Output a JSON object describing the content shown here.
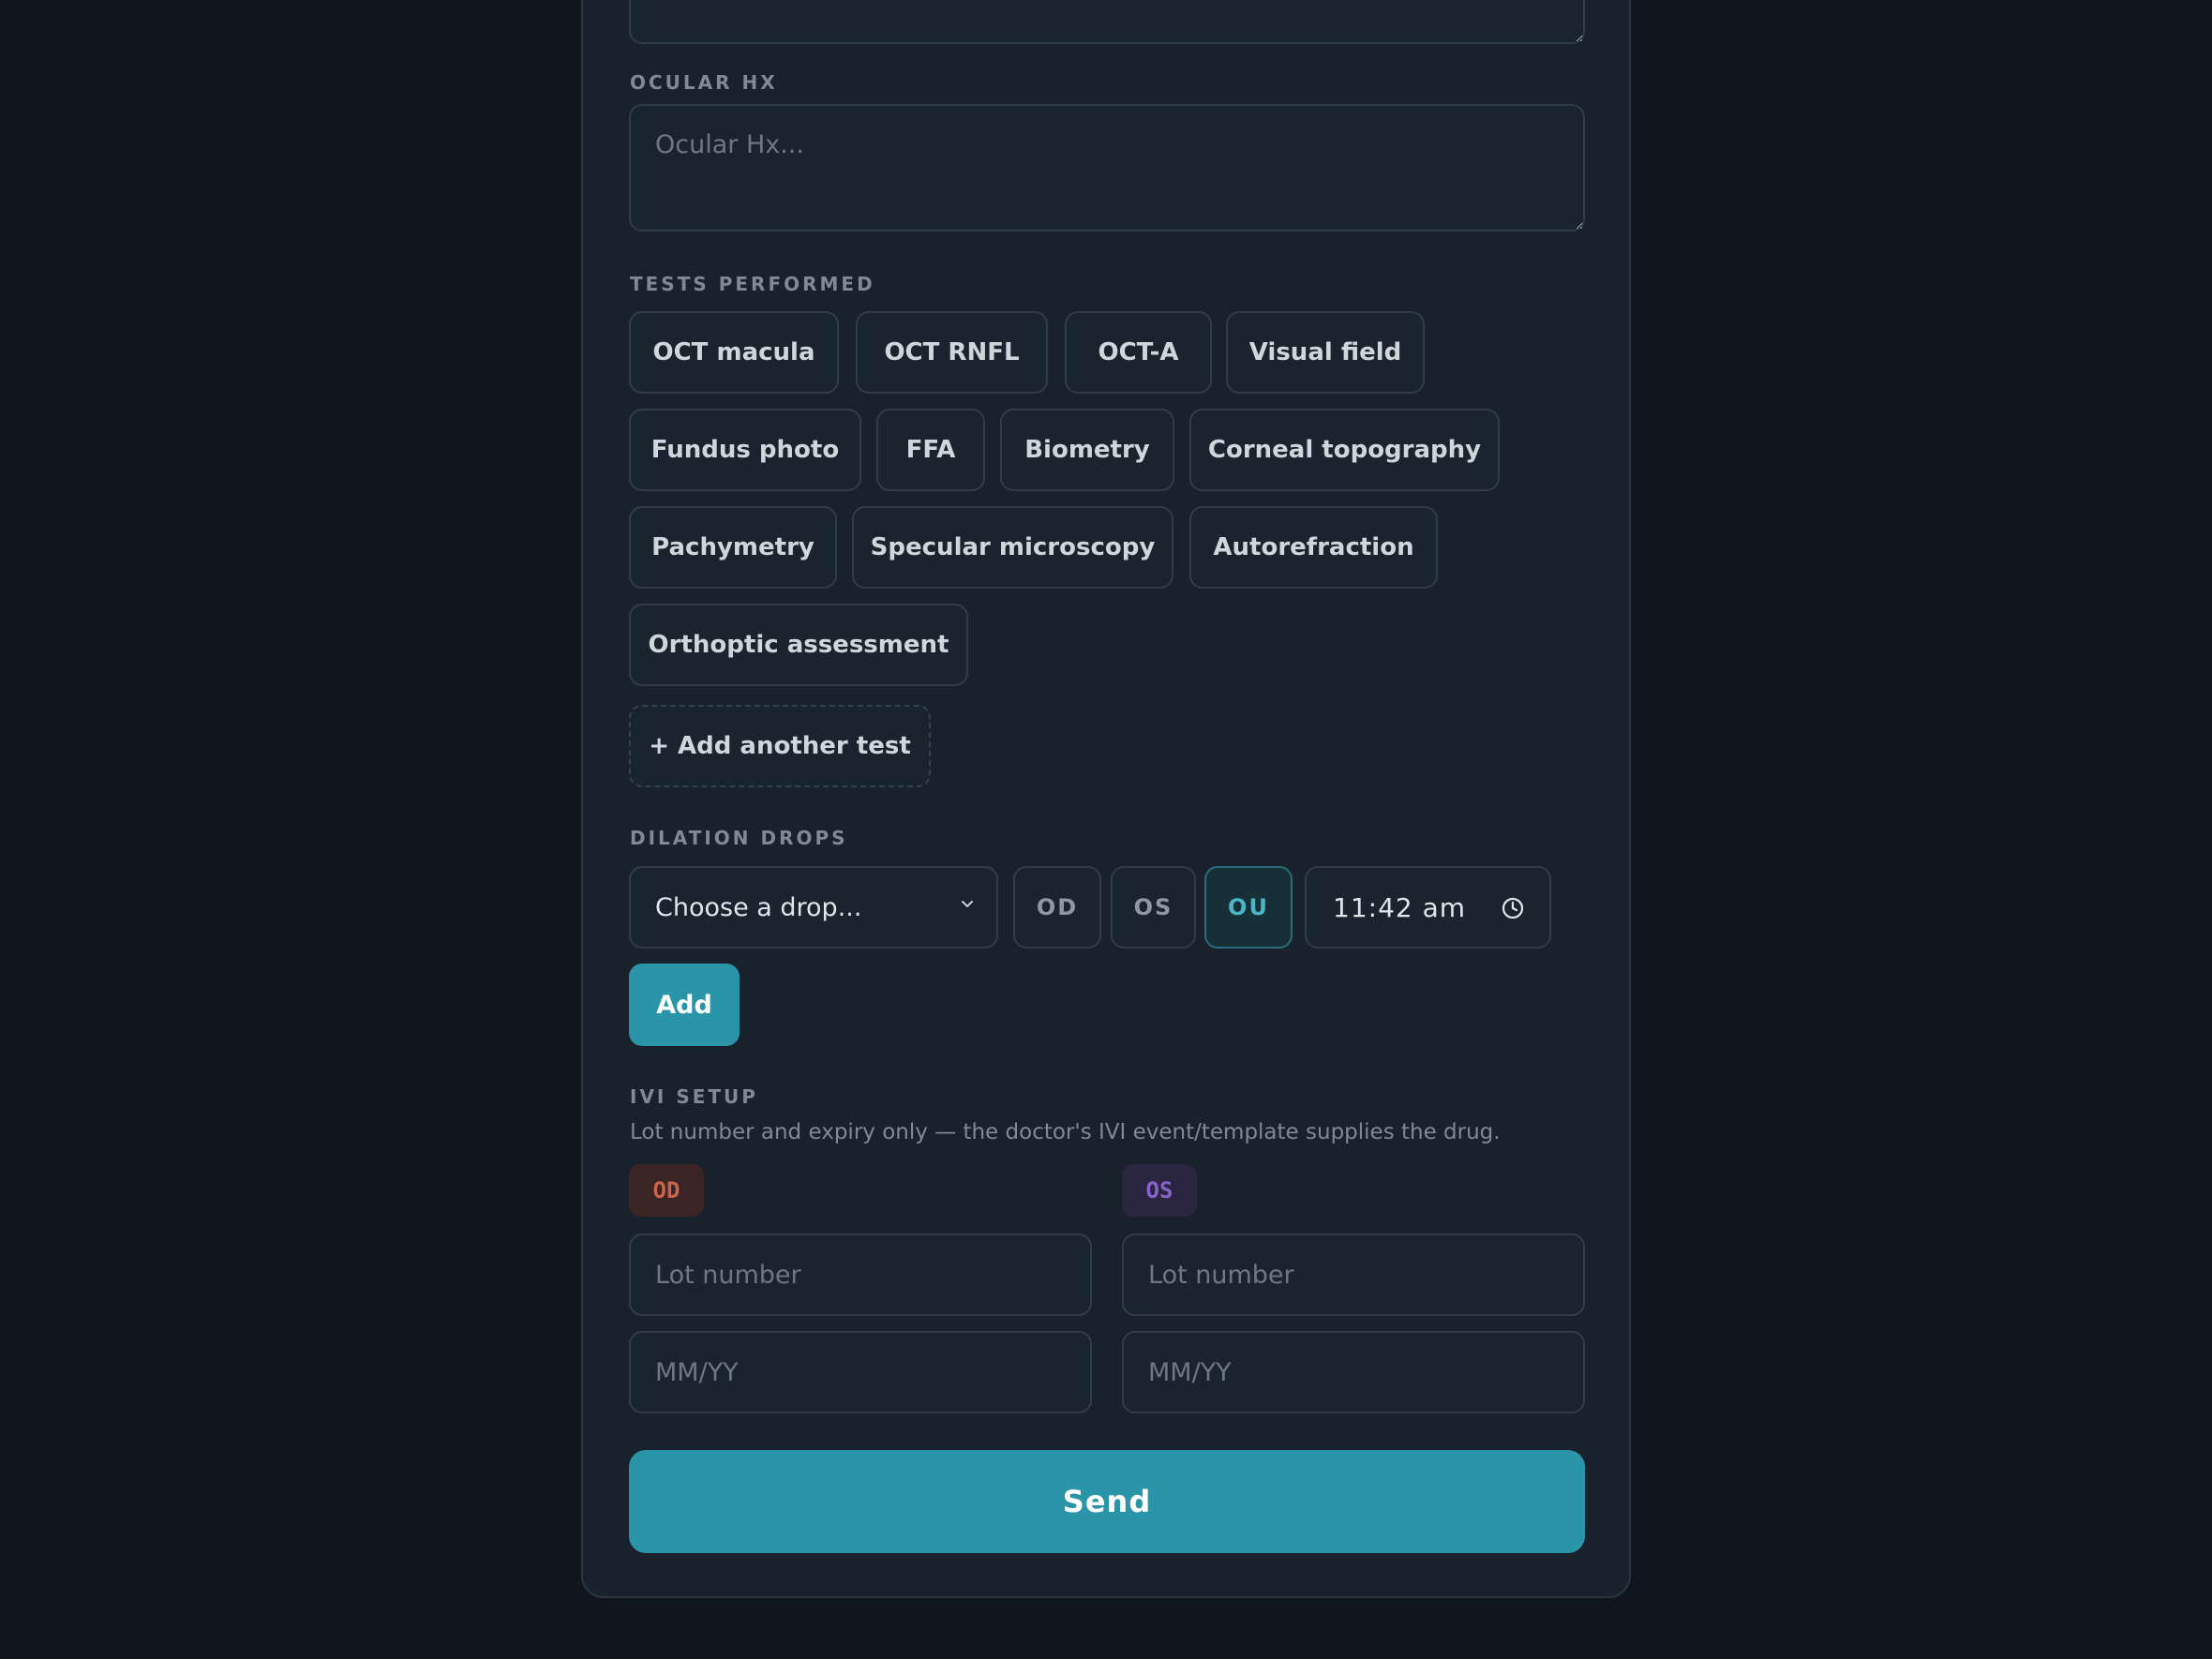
{
  "ocular_hx": {
    "label": "OCULAR HX",
    "placeholder": "Ocular Hx..."
  },
  "tests": {
    "label": "TESTS PERFORMED",
    "items": [
      "OCT macula",
      "OCT RNFL",
      "OCT-A",
      "Visual field",
      "Fundus photo",
      "FFA",
      "Biometry",
      "Corneal topography",
      "Pachymetry",
      "Specular microscopy",
      "Autorefraction",
      "Orthoptic assessment"
    ],
    "add_label": "+ Add another test"
  },
  "dilation": {
    "label": "DILATION DROPS",
    "select_placeholder": "Choose a drop...",
    "eyes": [
      "OD",
      "OS",
      "OU"
    ],
    "selected_eye": "OU",
    "time": "11:42 am",
    "add_label": "Add"
  },
  "ivi": {
    "label": "IVI SETUP",
    "hint": "Lot number and expiry only — the doctor's IVI event/template supplies the drug.",
    "od_badge": "OD",
    "os_badge": "OS",
    "lot_placeholder": "Lot number",
    "expiry_placeholder": "MM/YY",
    "od_color": "#c8654a",
    "os_color": "#8a63c9"
  },
  "send_label": "Send"
}
